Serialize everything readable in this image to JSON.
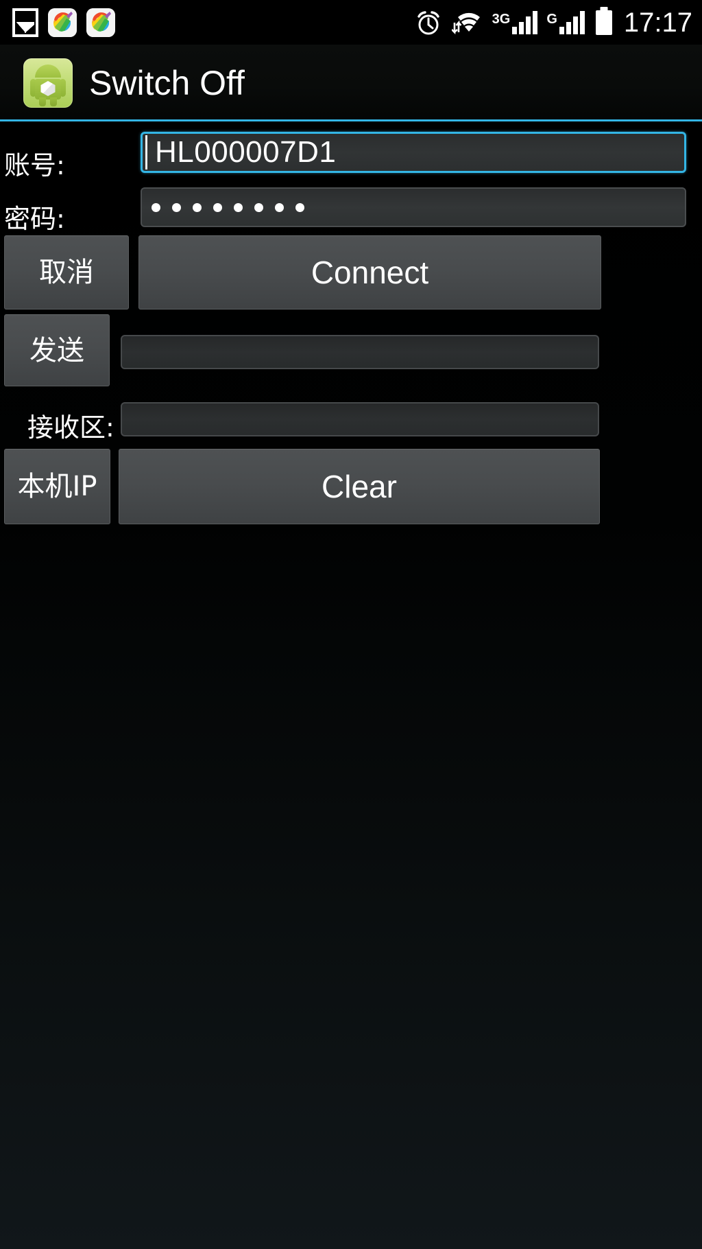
{
  "status_bar": {
    "time": "17:17",
    "left_icons": [
      {
        "name": "gallery-screenshot-icon",
        "label": "screenshot"
      },
      {
        "name": "app-notification-icon-1",
        "label": "rainbow-app"
      },
      {
        "name": "app-notification-icon-2",
        "label": "rainbow-app"
      }
    ],
    "right_icons": [
      {
        "name": "alarm-clock-icon",
        "label": "alarm"
      },
      {
        "name": "wifi-icon",
        "label": "wifi-data"
      },
      {
        "name": "signal-3g-icon",
        "label": "3G",
        "bars": 4
      },
      {
        "name": "signal-g-icon",
        "label": "G",
        "bars": 4
      },
      {
        "name": "battery-icon",
        "label": "battery-full"
      }
    ],
    "network_labels": {
      "primary": "3G",
      "secondary": "G"
    }
  },
  "title_bar": {
    "app_name": "Switch Off",
    "icon": "android-robot-icon",
    "accent_color": "#33b5e5"
  },
  "form": {
    "account": {
      "label": "账号:",
      "value": "HL000007D1",
      "placeholder": "",
      "focused": true
    },
    "password": {
      "label": "密码:",
      "value": "••••••••",
      "mask_count": 8,
      "placeholder": ""
    },
    "send": {
      "button_label": "发送",
      "input_value": "",
      "placeholder": ""
    },
    "receive": {
      "label": "接收区:",
      "value": "",
      "placeholder": ""
    }
  },
  "buttons": {
    "cancel": "取消",
    "connect": "Connect",
    "local_ip": "本机IP",
    "clear": "Clear"
  },
  "theme": {
    "accent": "#33b5e5",
    "background": "#000000",
    "field_bg": "#303334",
    "button_bg": "#4a4d4f",
    "text": "#ffffff"
  }
}
